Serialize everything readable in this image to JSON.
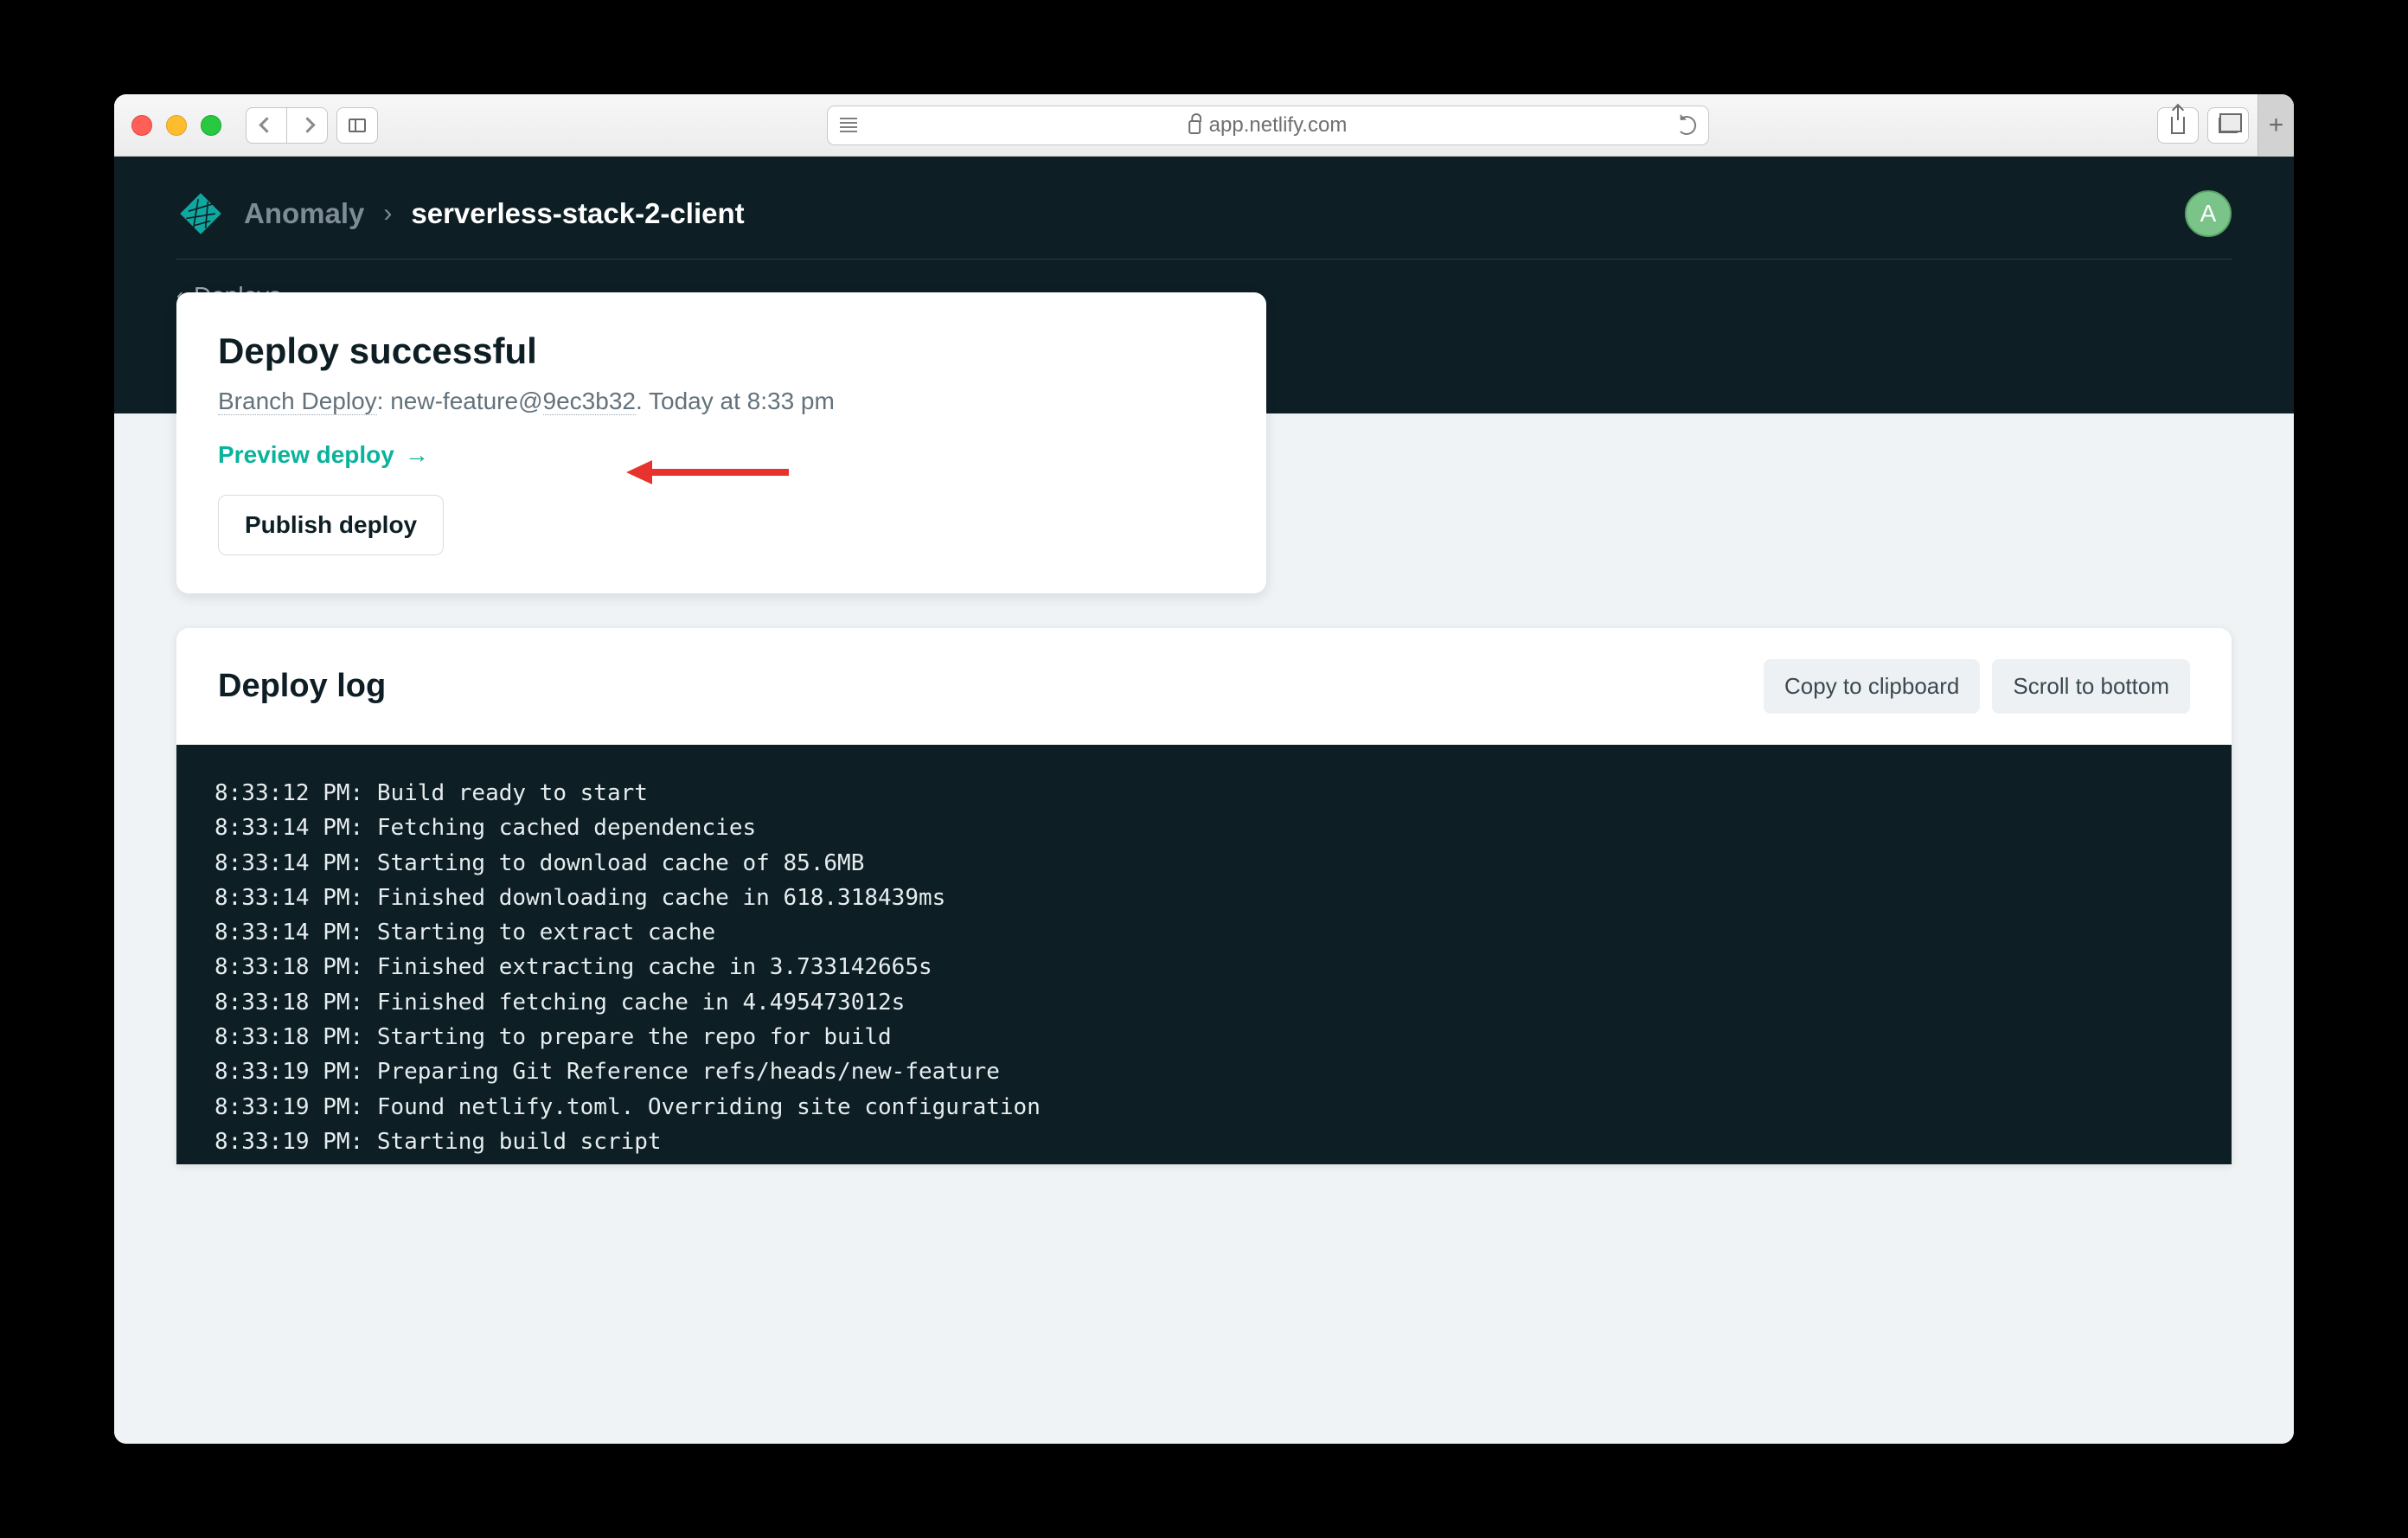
{
  "browser": {
    "url_host": "app.netlify.com"
  },
  "header": {
    "team": "Anomaly",
    "site": "serverless-stack-2-client",
    "avatar_letter": "A"
  },
  "backlink": "Deploys",
  "card": {
    "title": "Deploy successful",
    "meta_label": "Branch Deploy",
    "meta_branch": "new-feature",
    "meta_sep": "@",
    "meta_hash": "9ec3b32",
    "meta_suffix": ". Today at 8:33 pm",
    "preview_label": "Preview deploy",
    "publish_label": "Publish deploy"
  },
  "log": {
    "title": "Deploy log",
    "copy_label": "Copy to clipboard",
    "scroll_label": "Scroll to bottom",
    "lines": "8:33:12 PM: Build ready to start\n8:33:14 PM: Fetching cached dependencies\n8:33:14 PM: Starting to download cache of 85.6MB\n8:33:14 PM: Finished downloading cache in 618.318439ms\n8:33:14 PM: Starting to extract cache\n8:33:18 PM: Finished extracting cache in 3.733142665s\n8:33:18 PM: Finished fetching cache in 4.495473012s\n8:33:18 PM: Starting to prepare the repo for build\n8:33:19 PM: Preparing Git Reference refs/heads/new-feature\n8:33:19 PM: Found netlify.toml. Overriding site configuration\n8:33:19 PM: Starting build script"
  }
}
